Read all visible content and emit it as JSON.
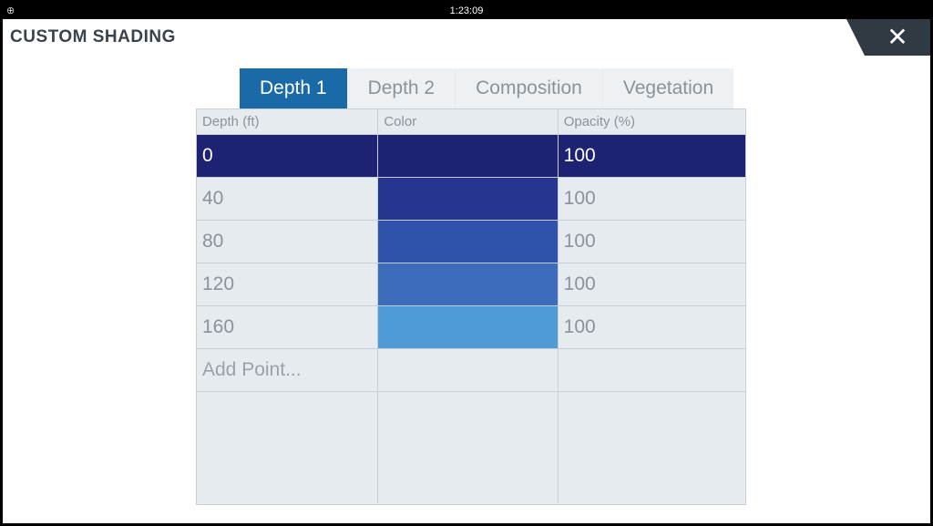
{
  "status": {
    "time": "1:23:09"
  },
  "header": {
    "title": "CUSTOM SHADING"
  },
  "tabs": [
    {
      "label": "Depth 1",
      "active": true
    },
    {
      "label": "Depth 2",
      "active": false
    },
    {
      "label": "Composition",
      "active": false
    },
    {
      "label": "Vegetation",
      "active": false
    }
  ],
  "columns": {
    "depth": "Depth (ft)",
    "color": "Color",
    "opacity": "Opacity (%)"
  },
  "rows": [
    {
      "depth": "0",
      "color": "#1d2273",
      "opacity": "100",
      "selected": true
    },
    {
      "depth": "40",
      "color": "#26358f",
      "opacity": "100",
      "selected": false
    },
    {
      "depth": "80",
      "color": "#2e53a9",
      "opacity": "100",
      "selected": false
    },
    {
      "depth": "120",
      "color": "#3d6cbd",
      "opacity": "100",
      "selected": false
    },
    {
      "depth": "160",
      "color": "#4e9bd5",
      "opacity": "100",
      "selected": false
    }
  ],
  "add_point": "Add Point..."
}
